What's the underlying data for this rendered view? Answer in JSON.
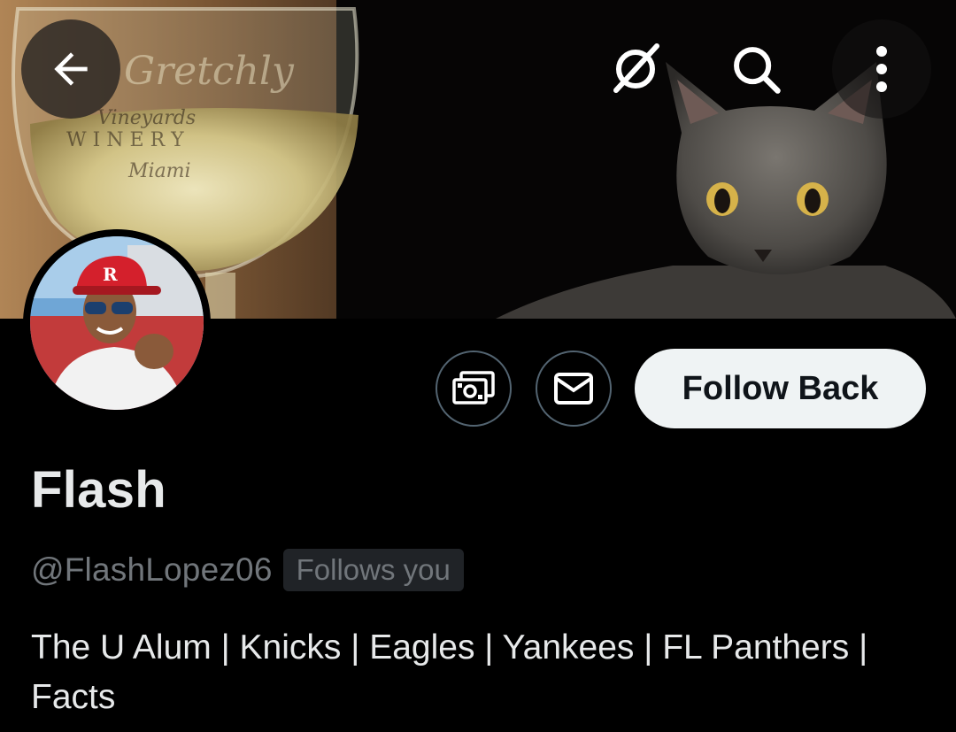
{
  "header": {
    "back_icon": "arrow-left-icon",
    "grok_icon": "grok-icon",
    "search_icon": "search-icon",
    "more_icon": "more-vertical-icon"
  },
  "banner": {
    "description_icon": "banner-image",
    "glass_text_1": "Gretchly",
    "glass_text_2": "Vineyards",
    "glass_text_3": "W I N E R Y",
    "glass_text_4": "Miami"
  },
  "actions": {
    "tips_icon": "money-icon",
    "message_icon": "envelope-icon",
    "follow_label": "Follow Back"
  },
  "profile": {
    "display_name": "Flash",
    "handle": "@FlashLopez06",
    "follows_you": "Follows you",
    "bio": "The U Alum | Knicks | Eagles | Yankees | FL Panthers | Facts"
  },
  "colors": {
    "background": "#000000",
    "text_primary": "#e7e9ea",
    "text_secondary": "#71767b",
    "button_bg": "#eff3f4",
    "border": "#536471"
  }
}
